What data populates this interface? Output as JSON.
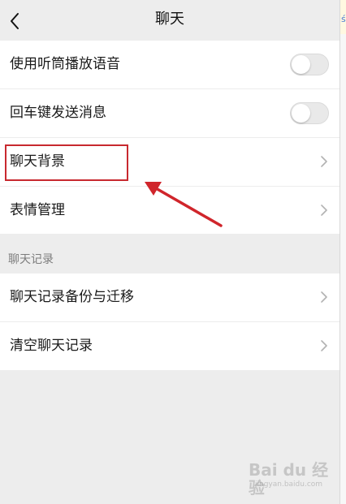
{
  "header": {
    "title": "聊天"
  },
  "group1": {
    "items": [
      {
        "label": "使用听筒播放语音",
        "control": "toggle",
        "value": "off"
      },
      {
        "label": "回车键发送消息",
        "control": "toggle",
        "value": "off"
      },
      {
        "label": "聊天背景",
        "control": "chevron"
      },
      {
        "label": "表情管理",
        "control": "chevron"
      }
    ]
  },
  "section": {
    "label": "聊天记录"
  },
  "group2": {
    "items": [
      {
        "label": "聊天记录备份与迁移",
        "control": "chevron"
      },
      {
        "label": "清空聊天记录",
        "control": "chevron"
      }
    ]
  },
  "annotation": {
    "highlight_color": "#c8292f",
    "target": "聊天背景"
  },
  "watermark": {
    "text": "Bai du 经验",
    "sub": "jingyan.baidu.com"
  },
  "edge": {
    "fragment": "ś"
  },
  "icons": {
    "back": "chevron-left-icon",
    "row_arrow": "chevron-right-icon"
  }
}
